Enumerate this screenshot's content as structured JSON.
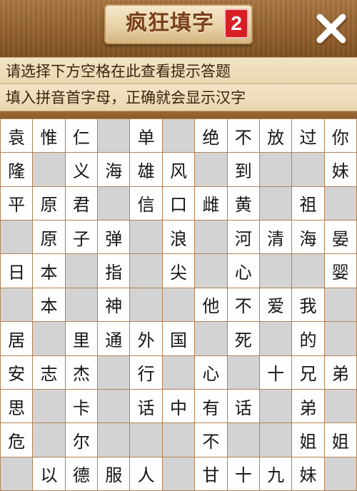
{
  "header": {
    "title": "疯狂填字",
    "level_badge": "2",
    "close_icon": "close-icon"
  },
  "hints": {
    "line1": "请选择下方空格在此查看提示答题",
    "line2": "填入拼音首字母，正确就会显示汉字"
  },
  "grid": [
    [
      "袁",
      "惟",
      "仁",
      "#",
      "单",
      "#",
      "绝",
      "不",
      "放",
      "过",
      "你"
    ],
    [
      "隆",
      "#",
      "义",
      "海",
      "雄",
      "风",
      "#",
      "到",
      "#",
      "#",
      "妹"
    ],
    [
      "平",
      "原",
      "君",
      "#",
      "信",
      "口",
      "雌",
      "黄",
      "#",
      "祖",
      "#"
    ],
    [
      "#",
      "原",
      "子",
      "弹",
      "#",
      "浪",
      "#",
      "河",
      "清",
      "海",
      "晏"
    ],
    [
      "日",
      "本",
      "#",
      "指",
      "#",
      "尖",
      "#",
      "心",
      "#",
      "#",
      "婴"
    ],
    [
      "#",
      "本",
      "#",
      "神",
      "#",
      "#",
      "他",
      "不",
      "爱",
      "我",
      "#"
    ],
    [
      "居",
      "#",
      "里",
      "通",
      "外",
      "国",
      "#",
      "死",
      "#",
      "的",
      "#"
    ],
    [
      "安",
      "志",
      "杰",
      "#",
      "行",
      "#",
      "心",
      "#",
      "十",
      "兄",
      "弟"
    ],
    [
      "思",
      "#",
      "卡",
      "#",
      "话",
      "中",
      "有",
      "话",
      "#",
      "弟",
      "#"
    ],
    [
      "危",
      "#",
      "尔",
      "#",
      "#",
      "#",
      "不",
      "#",
      "#",
      "姐",
      "姐"
    ],
    [
      "#",
      "以",
      "德",
      "服",
      "人",
      "#",
      "甘",
      "十",
      "九",
      "妹",
      "#"
    ]
  ]
}
